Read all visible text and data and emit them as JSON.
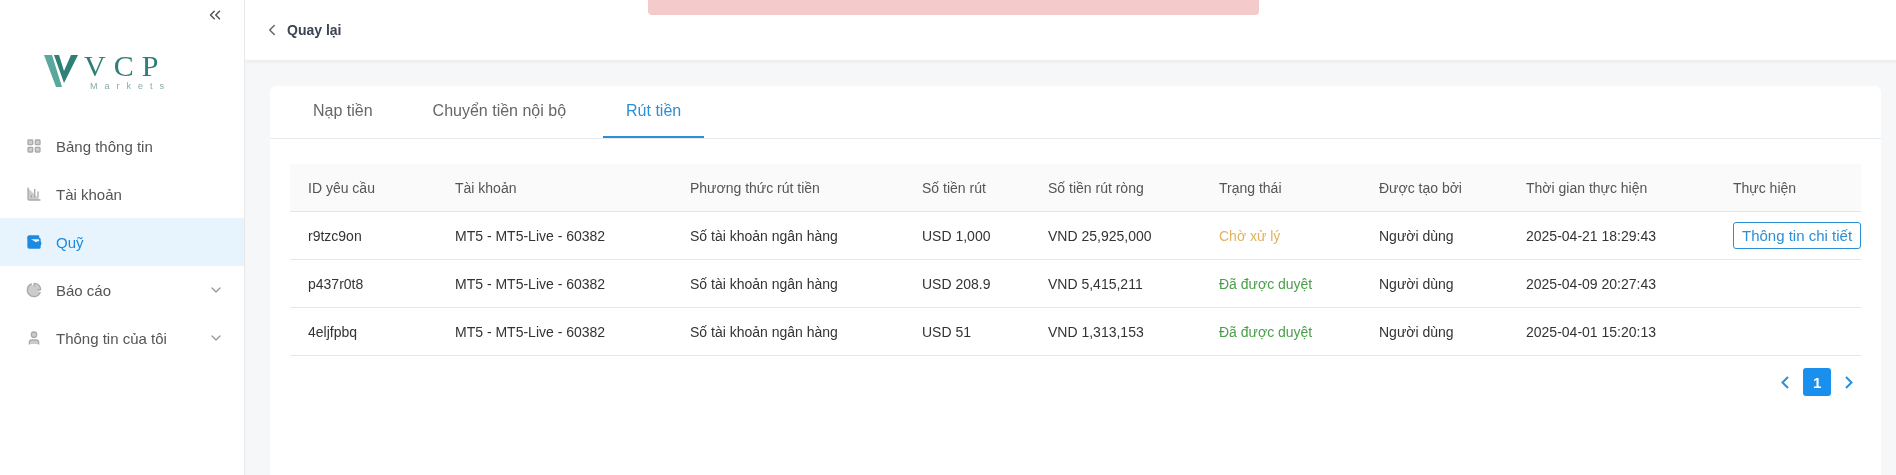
{
  "sidebar": {
    "logo": {
      "name": "VCP",
      "tagline": "Markets"
    },
    "items": [
      {
        "label": "Bảng thông tin",
        "selected": false,
        "expandable": false
      },
      {
        "label": "Tài khoản",
        "selected": false,
        "expandable": false
      },
      {
        "label": "Quỹ",
        "selected": true,
        "expandable": false
      },
      {
        "label": "Báo cáo",
        "selected": false,
        "expandable": true
      },
      {
        "label": "Thông tin của tôi",
        "selected": false,
        "expandable": true
      }
    ]
  },
  "header": {
    "back": "Quay lại",
    "toast": {
      "kind": "error"
    }
  },
  "tabs": [
    {
      "label": "Nạp tiền",
      "selected": false
    },
    {
      "label": "Chuyển tiền nội bộ",
      "selected": false
    },
    {
      "label": "Rút tiền",
      "selected": true
    }
  ],
  "table": {
    "columns": [
      "ID yêu cầu",
      "Tài khoản",
      "Phương thức rút tiền",
      "Số tiền rút",
      "Số tiền rút ròng",
      "Trạng thái",
      "Được tạo bởi",
      "Thời gian thực hiện",
      "Thực hiện"
    ],
    "rows": [
      {
        "id": "r9tzc9on",
        "account": "MT5 - MT5-Live - 60382",
        "method": "Số tài khoản ngân hàng",
        "amount": "USD 1,000",
        "net": "VND 25,925,000",
        "status": {
          "label": "Chờ xử lý",
          "kind": "pending"
        },
        "created_by": "Người dùng",
        "time": "2025-04-21 18:29:43",
        "action": "Thông tin chi tiết"
      },
      {
        "id": "p437r0t8",
        "account": "MT5 - MT5-Live - 60382",
        "method": "Số tài khoản ngân hàng",
        "amount": "USD 208.9",
        "net": "VND 5,415,211",
        "status": {
          "label": "Đã được duyệt",
          "kind": "approved"
        },
        "created_by": "Người dùng",
        "time": "2025-04-09 20:27:43"
      },
      {
        "id": "4eljfpbq",
        "account": "MT5 - MT5-Live - 60382",
        "method": "Số tài khoản ngân hàng",
        "amount": "USD 51",
        "net": "VND 1,313,153",
        "status": {
          "label": "Đã được duyệt",
          "kind": "approved"
        },
        "created_by": "Người dùng",
        "time": "2025-04-01 15:20:13"
      }
    ]
  },
  "pagination": {
    "pages": [
      {
        "label": "1",
        "selected": true
      }
    ]
  }
}
